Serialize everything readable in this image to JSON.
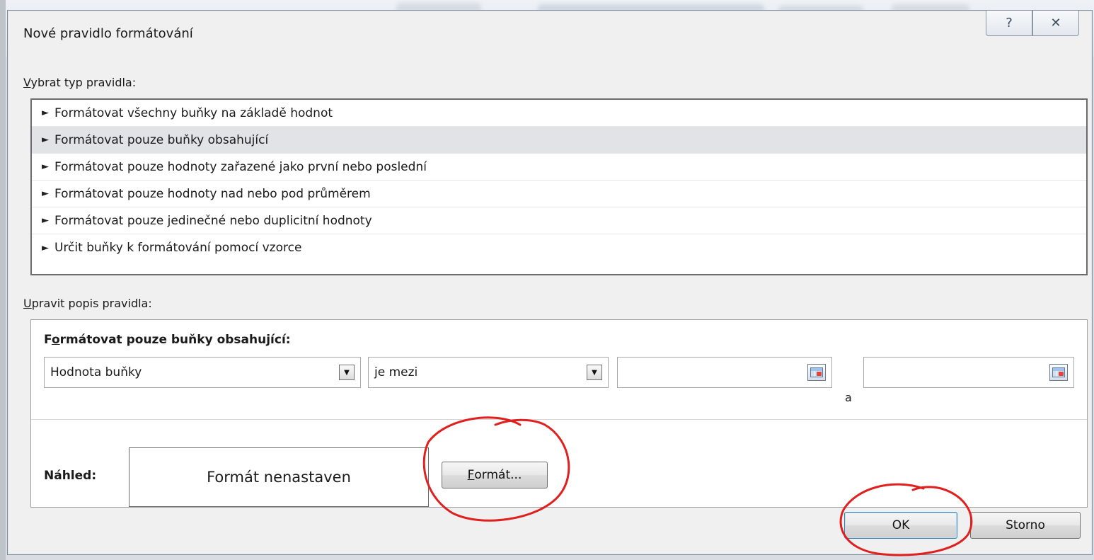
{
  "dialog": {
    "title": "Nové pravidlo formátování",
    "help_glyph": "?",
    "close_glyph": "✕"
  },
  "rule_type": {
    "label_first": "V",
    "label_rest": "ybrat typ pravidla:",
    "items": [
      "Formátovat všechny buňky na základě hodnot",
      "Formátovat pouze buňky obsahující",
      "Formátovat pouze hodnoty zařazené jako první nebo poslední",
      "Formátovat pouze hodnoty nad nebo pod průměrem",
      "Formátovat pouze jedinečné nebo duplicitní hodnoty",
      "Určit buňky k formátování pomocí vzorce"
    ],
    "selected_index": 1
  },
  "description": {
    "label_first": "U",
    "label_rest": "pravit popis pravidla:",
    "heading_pre": "F",
    "heading_ul": "o",
    "heading_post": "rmátovat pouze buňky obsahující:",
    "condition_field": "Hodnota buňky",
    "operator": "je mezi",
    "value1": "",
    "value2": "",
    "and_label": "a",
    "preview_label": "Náhled:",
    "preview_text": "Formát nenastaven",
    "format_button_first": "F",
    "format_button_rest": "ormát..."
  },
  "footer": {
    "ok_label": "OK",
    "cancel_label": "Storno"
  },
  "colors": {
    "annotation": "#e0201e",
    "selected_row": "#e2e3e6"
  }
}
